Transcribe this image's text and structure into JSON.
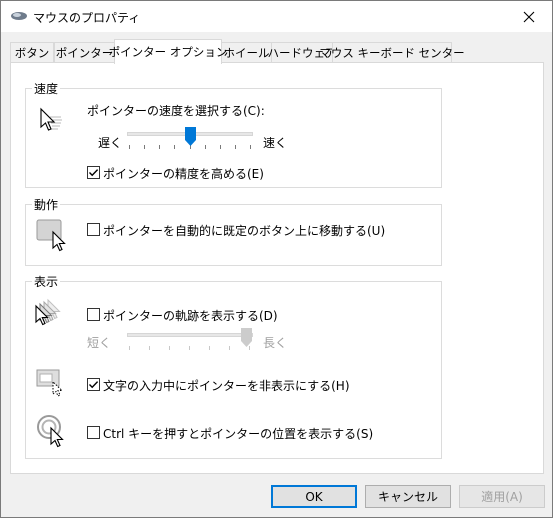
{
  "window": {
    "title": "マウスのプロパティ"
  },
  "tabs": [
    {
      "label": "ボタン"
    },
    {
      "label": "ポインター"
    },
    {
      "label": "ポインター オプション"
    },
    {
      "label": "ホイール"
    },
    {
      "label": "ハードウェア"
    },
    {
      "label": "マウス キーボード センター"
    }
  ],
  "active_tab": "ポインター オプション",
  "speed": {
    "title": "速度",
    "prompt": "ポインターの速度を選択する(C):",
    "slow_label": "遅く",
    "fast_label": "速く",
    "slider_value": 0.5,
    "precision_label": "ポインターの精度を高める(E)",
    "precision_checked": true
  },
  "motion": {
    "title": "動作",
    "snap_label": "ポインターを自動的に既定のボタン上に移動する(U)",
    "snap_checked": false
  },
  "visibility": {
    "title": "表示",
    "trails_label": "ポインターの軌跡を表示する(D)",
    "trails_checked": false,
    "short_label": "短く",
    "long_label": "長く",
    "trails_value": 1.0,
    "hide_typing_label": "文字の入力中にポインターを非表示にする(H)",
    "hide_typing_checked": true,
    "ctrl_label": "Ctrl キーを押すとポインターの位置を表示する(S)",
    "ctrl_checked": false
  },
  "buttons": {
    "ok": "OK",
    "cancel": "キャンセル",
    "apply": "適用(A)"
  },
  "colors": {
    "accent": "#0078d7",
    "disabled_text": "#a0a0a0"
  },
  "icons": [
    "mouse-icon",
    "close-icon",
    "speed-pointer-icon",
    "snap-pointer-icon",
    "trails-pointer-icon",
    "hide-pointer-icon",
    "locate-pointer-icon",
    "checkmark-icon"
  ]
}
